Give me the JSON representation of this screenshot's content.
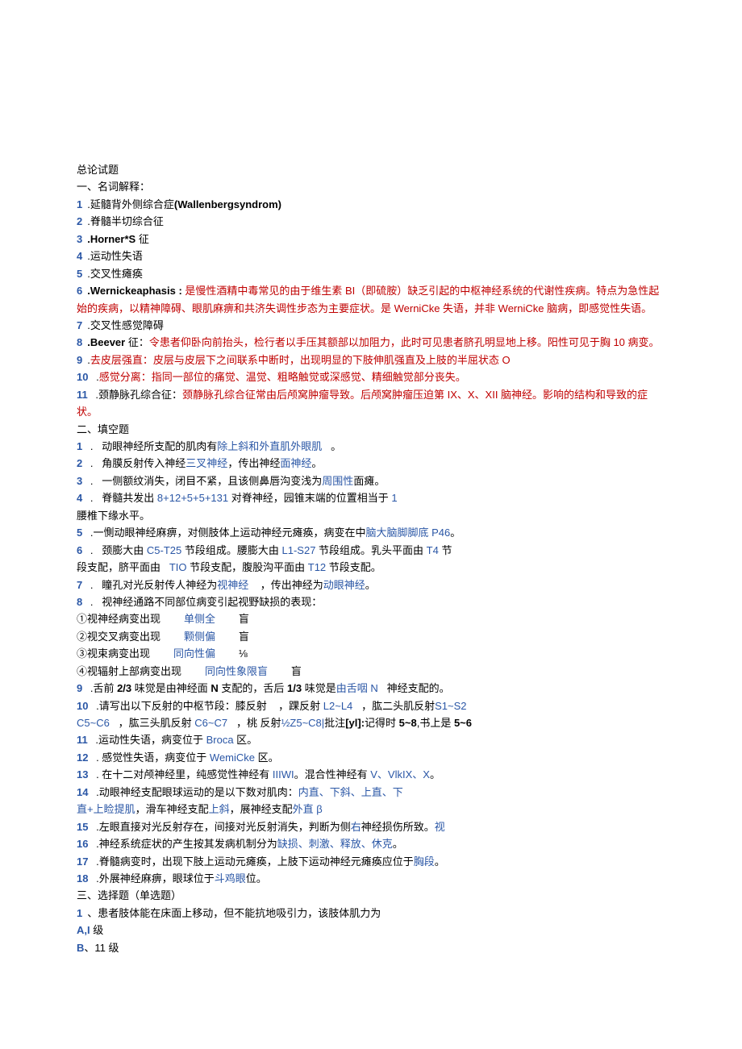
{
  "title": "总论试题",
  "sec1_heading": "一、名词解释：",
  "sec1": [
    {
      "n": "1",
      "txt": ".延髓背外侧综合症",
      "extra": "(Wallenbergsyndrom)"
    },
    {
      "n": "2",
      "txt": ".脊髓半切综合征"
    },
    {
      "n": "3",
      "bold": ".Horner*S",
      "txt": " 征"
    },
    {
      "n": "4",
      "txt": ".运动性失语"
    },
    {
      "n": "5",
      "txt": ".交叉性瘫痪"
    },
    {
      "n": "6",
      "bold": ".Wernickeaphasis : ",
      "red": "是慢性酒精中毒常见的由于维生素 BI（即硫胺）缺乏引起的中枢神经系统的代谢性疾病。特点为急性起始的疾病，以精神障碍、眼肌麻痹和共济失调性步态为主要症状。是 WerniCke 失语，并非 WerniCke 脑病，即感觉性失语。"
    },
    {
      "n": "7",
      "txt": ".交叉性感觉障碍"
    },
    {
      "n": "8",
      "bold": ".Beever",
      "txt": " 征：",
      "red": "令患者仰卧向前抬头，检行者以手压其额部以加阻力，此时可见患者脐孔明显地上移。阳性可见于胸 10 病变。"
    },
    {
      "n": "9",
      "txt": ".",
      "red": "去皮层强直：皮层与皮层下之间联系中断时，出现明显的下肢伸肌强直及上肢的半屈状态 O"
    },
    {
      "n": "10",
      "txt": " .",
      "red": "感觉分离：指同一部位的痛觉、温觉、粗略触觉或深感觉、精细触觉部分丧失。"
    },
    {
      "n": "11",
      "txt": " .颈静脉孔综合征：",
      "red": "颈静脉孔综合征常由后颅窝肿瘤导致。后颅窝肿瘤压迫第 IX、X、XII 脑神经。影响的结构和导致的症状。"
    }
  ],
  "sec2_heading": "二、填空题",
  "sec2": [
    {
      "n": "1",
      "txt": " .   动眼神经所支配的肌肉有",
      "ans": "除上斜和外直肌外眼肌",
      "post": "   。"
    },
    {
      "n": "2",
      "txt": " .   角膜反射传入神经",
      "ans": "三叉神经",
      "post": "，传出神经",
      "ans2": "面神经",
      "post2": "。"
    },
    {
      "n": "3",
      "txt": " .   一侧额纹消失，闭目不紧，且该侧鼻唇沟变浅为",
      "ans": "周围性",
      "post": "面瘫。"
    },
    {
      "n": "4",
      "txt": " .   脊髓共发出 ",
      "ans": "8+12+5+5+131",
      "post": " 对脊神经，园锥末端的位置相当于 ",
      "ans2": "1",
      "post2": ""
    },
    {
      "cont": "腰椎下缘水平。"
    },
    {
      "n": "5",
      "txt": " .一惻动眼神经麻痹，对侧肢体上运动神经元瘫痪，病变在中",
      "ans": "脑大脑脚脚底 P46",
      "post": "。"
    },
    {
      "n": "6",
      "txt": " .   颈膨大由 ",
      "ans": "C5-T25",
      "post": " 节段组成。腰膨大由 ",
      "ans2": "L1-S27",
      "post2": " 节段组成。乳头平面由 ",
      "ans3": "T4",
      "post3": " 节"
    },
    {
      "cont_pre": "段支配，脐平面由   ",
      "cont_ans": "TIO",
      "cont_mid": " 节段支配，腹股沟平面由 ",
      "cont_ans2": "T12",
      "cont_post": " 节段支配。"
    },
    {
      "n": "7",
      "txt": " .   瞳孔对光反射传人神经为",
      "ans": "视神经",
      "post": "    ，传出神经为",
      "ans2": "动眼神经",
      "post2": "。"
    },
    {
      "n": "8",
      "txt": " .   视神经通路不同部位病变引起视野缺损的表现："
    },
    {
      "circ": "①",
      "pre": "视神经病变出现",
      "ans": "单侧全",
      "post": "盲"
    },
    {
      "circ": "②",
      "pre": "视交叉病变出现",
      "ans": "颗侧偏",
      "post": "盲"
    },
    {
      "circ": "③",
      "pre": "视束病变出现",
      "ans": "同向性偏",
      "post": "⅛"
    },
    {
      "circ": "④",
      "pre": "视辐射上部病变出现",
      "ans": "同向性象限盲",
      "post": "盲"
    },
    {
      "n": "9",
      "txt": " .舌前 ",
      "bold": "2/3",
      "mid": " 味觉是由神经面 ",
      "bold2": "N",
      "mid2": " 支配的，舌后 ",
      "bold3": "1/3",
      "mid3": " 味觉是",
      "ans": "由舌咽 N",
      "post": "   神经支配的。"
    },
    {
      "n": "10",
      "txt": " .请写出以下反射的中枢节段：膝反射 ",
      "ans": "L2~L4",
      "mid": "   ，踝反射 ",
      "ans2": "S1~S2",
      "post": "   ，肱二头肌反射"
    },
    {
      "cont_ans": "C5~C6",
      "cont_mid": "   ，肱三头肌反射 ",
      "cont_ans2": "C6~C7",
      "cont_mid2": "   ，桃 反射",
      "cont_ans3": "½Z5~C8|",
      "cont_post": "批注",
      "cont_bold": "[yl]:",
      "cont_end": "记得时 ",
      "cont_bold2": "5~8",
      "cont_end2": ",书上是 ",
      "cont_bold3": "5~6"
    },
    {
      "n": "11",
      "txt": " .运动性失语，病变位于 ",
      "ans": "Broca",
      "post": " 区。"
    },
    {
      "n": "12",
      "txt": " . 感觉性失语，病变位于 ",
      "ans": "WemiCke",
      "post": " 区。"
    },
    {
      "n": "13",
      "txt": " . 在十二对颅神经里，纯感觉性神经有 ",
      "ans": "IIIWI",
      "post": "。混合性神经有 ",
      "ans2": "V、VlkIX、X",
      "post2": "。"
    },
    {
      "n": "14",
      "txt": " .动眼神经支配眼球运动的是以下数对肌肉：",
      "ans": "内直、下斜、上直、下"
    },
    {
      "cont_ans": "直+上睑提肌",
      "cont_mid": "，滑车神经支配",
      "cont_ans2": "上斜",
      "cont_mid2": "，展神经支配",
      "cont_ans3": "外直 β"
    },
    {
      "n": "15",
      "txt": " .左眼直接对光反射存在，间接对光反射消失，判断为",
      "ans": "右",
      "mid": "侧",
      "ans2": "视",
      "post": "神经损伤所致。"
    },
    {
      "n": "16",
      "txt": " .神经系统症状的产生按其发病机制分为",
      "ans": "缺损、刺激、释放、休克",
      "post": "。"
    },
    {
      "n": "17",
      "txt": " .脊髓病变时，出现下肢上运动元瘫痪，上肢下运动神经元瘫痪应位于",
      "ans": "胸段",
      "post": "。"
    },
    {
      "n": "18",
      "txt": " .外展神经麻痹，眼球位于",
      "ans": "斗鸡眼",
      "post": "位。"
    }
  ],
  "sec3_heading": "三、选择题（单选题）",
  "sec3": [
    {
      "n": "1",
      "txt": "、患者肢体能在床面上移动，但不能抗地吸引力，该肢体肌力为"
    },
    {
      "opt": "A,I",
      "txt": " 级"
    },
    {
      "opt": "B",
      "txt": "、11 级"
    }
  ]
}
